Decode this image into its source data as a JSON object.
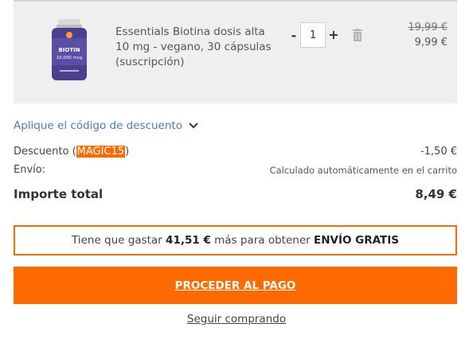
{
  "cart_item": {
    "name": "Essentials Biotina dosis alta 10 mg - vegano, 30 cápsulas (suscripción)",
    "bottle_label_line1": "BIOTIN",
    "bottle_label_line2": "10,000 mcg",
    "quantity": "1",
    "qty_minus_label": "-",
    "qty_plus_label": "+",
    "price_original": "19,99 €",
    "price_current": "9,99 €",
    "trash_icon": "trash-icon"
  },
  "discount_toggle": {
    "label": "Aplique el código de descuento",
    "icon": "chevron-down-icon"
  },
  "summary": {
    "discount_label": "Descuento (",
    "discount_code": "MAGIC15",
    "discount_label_close": ")",
    "discount_value": "-1,50 €",
    "shipping_label": "Envío:",
    "shipping_value": "Calculado automáticamente en el carrito",
    "total_label": "Importe total",
    "total_value": "8,49 €"
  },
  "free_shipping_banner": {
    "prefix": "Tiene que gastar ",
    "amount": "41,51 €",
    "middle": " más para obtener ",
    "highlight": "ENVÍO GRATIS"
  },
  "checkout_label": "PROCEDER AL PAGO",
  "continue_label": "Seguir comprando",
  "colors": {
    "accent": "#ff6a00",
    "link": "#4a7fb4",
    "panel": "#efefef",
    "bottle": "#4b3f8f"
  }
}
